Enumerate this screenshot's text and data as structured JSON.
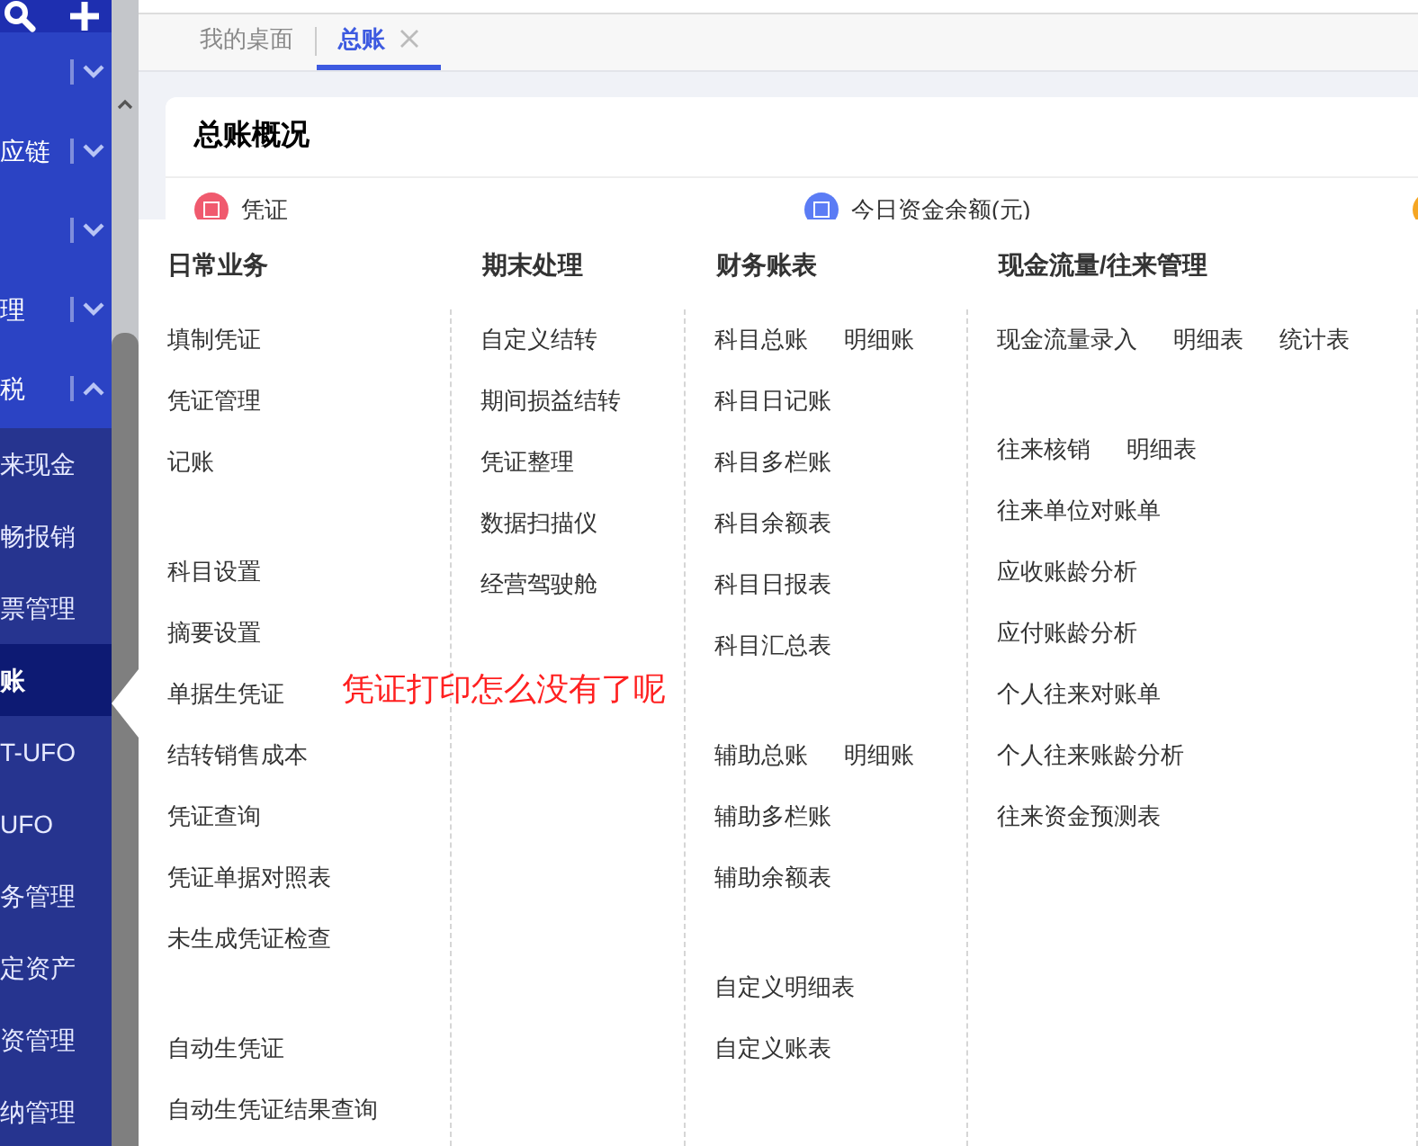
{
  "sidebar": {
    "groups": [
      {
        "expanded": false
      },
      {
        "label": "应链",
        "expanded": false
      },
      {
        "expanded": false
      },
      {
        "label": "理",
        "expanded": false
      },
      {
        "label": "税",
        "expanded": true
      }
    ],
    "items": [
      {
        "label": "来现金",
        "selected": false
      },
      {
        "label": "畅报销",
        "selected": false
      },
      {
        "label": "票管理",
        "selected": false
      },
      {
        "label": "账",
        "selected": true
      },
      {
        "label": "T-UFO",
        "selected": false
      },
      {
        "label": "UFO",
        "selected": false
      },
      {
        "label": "务管理",
        "selected": false
      },
      {
        "label": "定资产",
        "selected": false
      },
      {
        "label": "资管理",
        "selected": false
      },
      {
        "label": "纳管理",
        "selected": false
      }
    ]
  },
  "tabs": [
    {
      "label": "我的桌面",
      "selected": false,
      "closable": false
    },
    {
      "label": "总账",
      "selected": true,
      "closable": true
    }
  ],
  "card": {
    "title": "总账概况",
    "stats": [
      {
        "label": "凭证",
        "color": "#f05a6e"
      },
      {
        "label": "今日资金余额(元)",
        "color": "#5b7cf5"
      },
      {
        "color": "#f5a623"
      }
    ]
  },
  "menu": {
    "columns": [
      {
        "heading": "日常业务",
        "groups": [
          [
            [
              "填制凭证"
            ],
            [
              "凭证管理"
            ],
            [
              "记账"
            ]
          ],
          [
            [
              "科目设置"
            ],
            [
              "摘要设置"
            ],
            [
              "单据生凭证"
            ],
            [
              "结转销售成本"
            ],
            [
              "凭证查询"
            ],
            [
              "凭证单据对照表"
            ],
            [
              "未生成凭证检查"
            ]
          ],
          [
            [
              "自动生凭证"
            ],
            [
              "自动生凭证结果查询"
            ]
          ]
        ]
      },
      {
        "heading": "期末处理",
        "groups": [
          [
            [
              "自定义结转"
            ],
            [
              "期间损益结转"
            ],
            [
              "凭证整理"
            ],
            [
              "数据扫描仪"
            ],
            [
              "经营驾驶舱"
            ]
          ]
        ]
      },
      {
        "heading": "财务账表",
        "groups": [
          [
            [
              "科目总账",
              "明细账"
            ],
            [
              "科目日记账"
            ],
            [
              "科目多栏账"
            ],
            [
              "科目余额表"
            ],
            [
              "科目日报表"
            ],
            [
              "科目汇总表"
            ]
          ],
          [
            [
              "辅助总账",
              "明细账"
            ],
            [
              "辅助多栏账"
            ],
            [
              "辅助余额表"
            ]
          ],
          [
            [
              "自定义明细表"
            ],
            [
              "自定义账表"
            ]
          ]
        ]
      },
      {
        "heading": "现金流量/往来管理",
        "groups": [
          [
            [
              "现金流量录入",
              "明细表",
              "统计表"
            ]
          ],
          [
            [
              "往来核销",
              "明细表"
            ],
            [
              "往来单位对账单"
            ],
            [
              "应收账龄分析"
            ],
            [
              "应付账龄分析"
            ],
            [
              "个人往来对账单"
            ],
            [
              "个人往来账龄分析"
            ],
            [
              "往来资金预测表"
            ]
          ]
        ]
      }
    ],
    "annotation": "凭证打印怎么没有了呢"
  }
}
